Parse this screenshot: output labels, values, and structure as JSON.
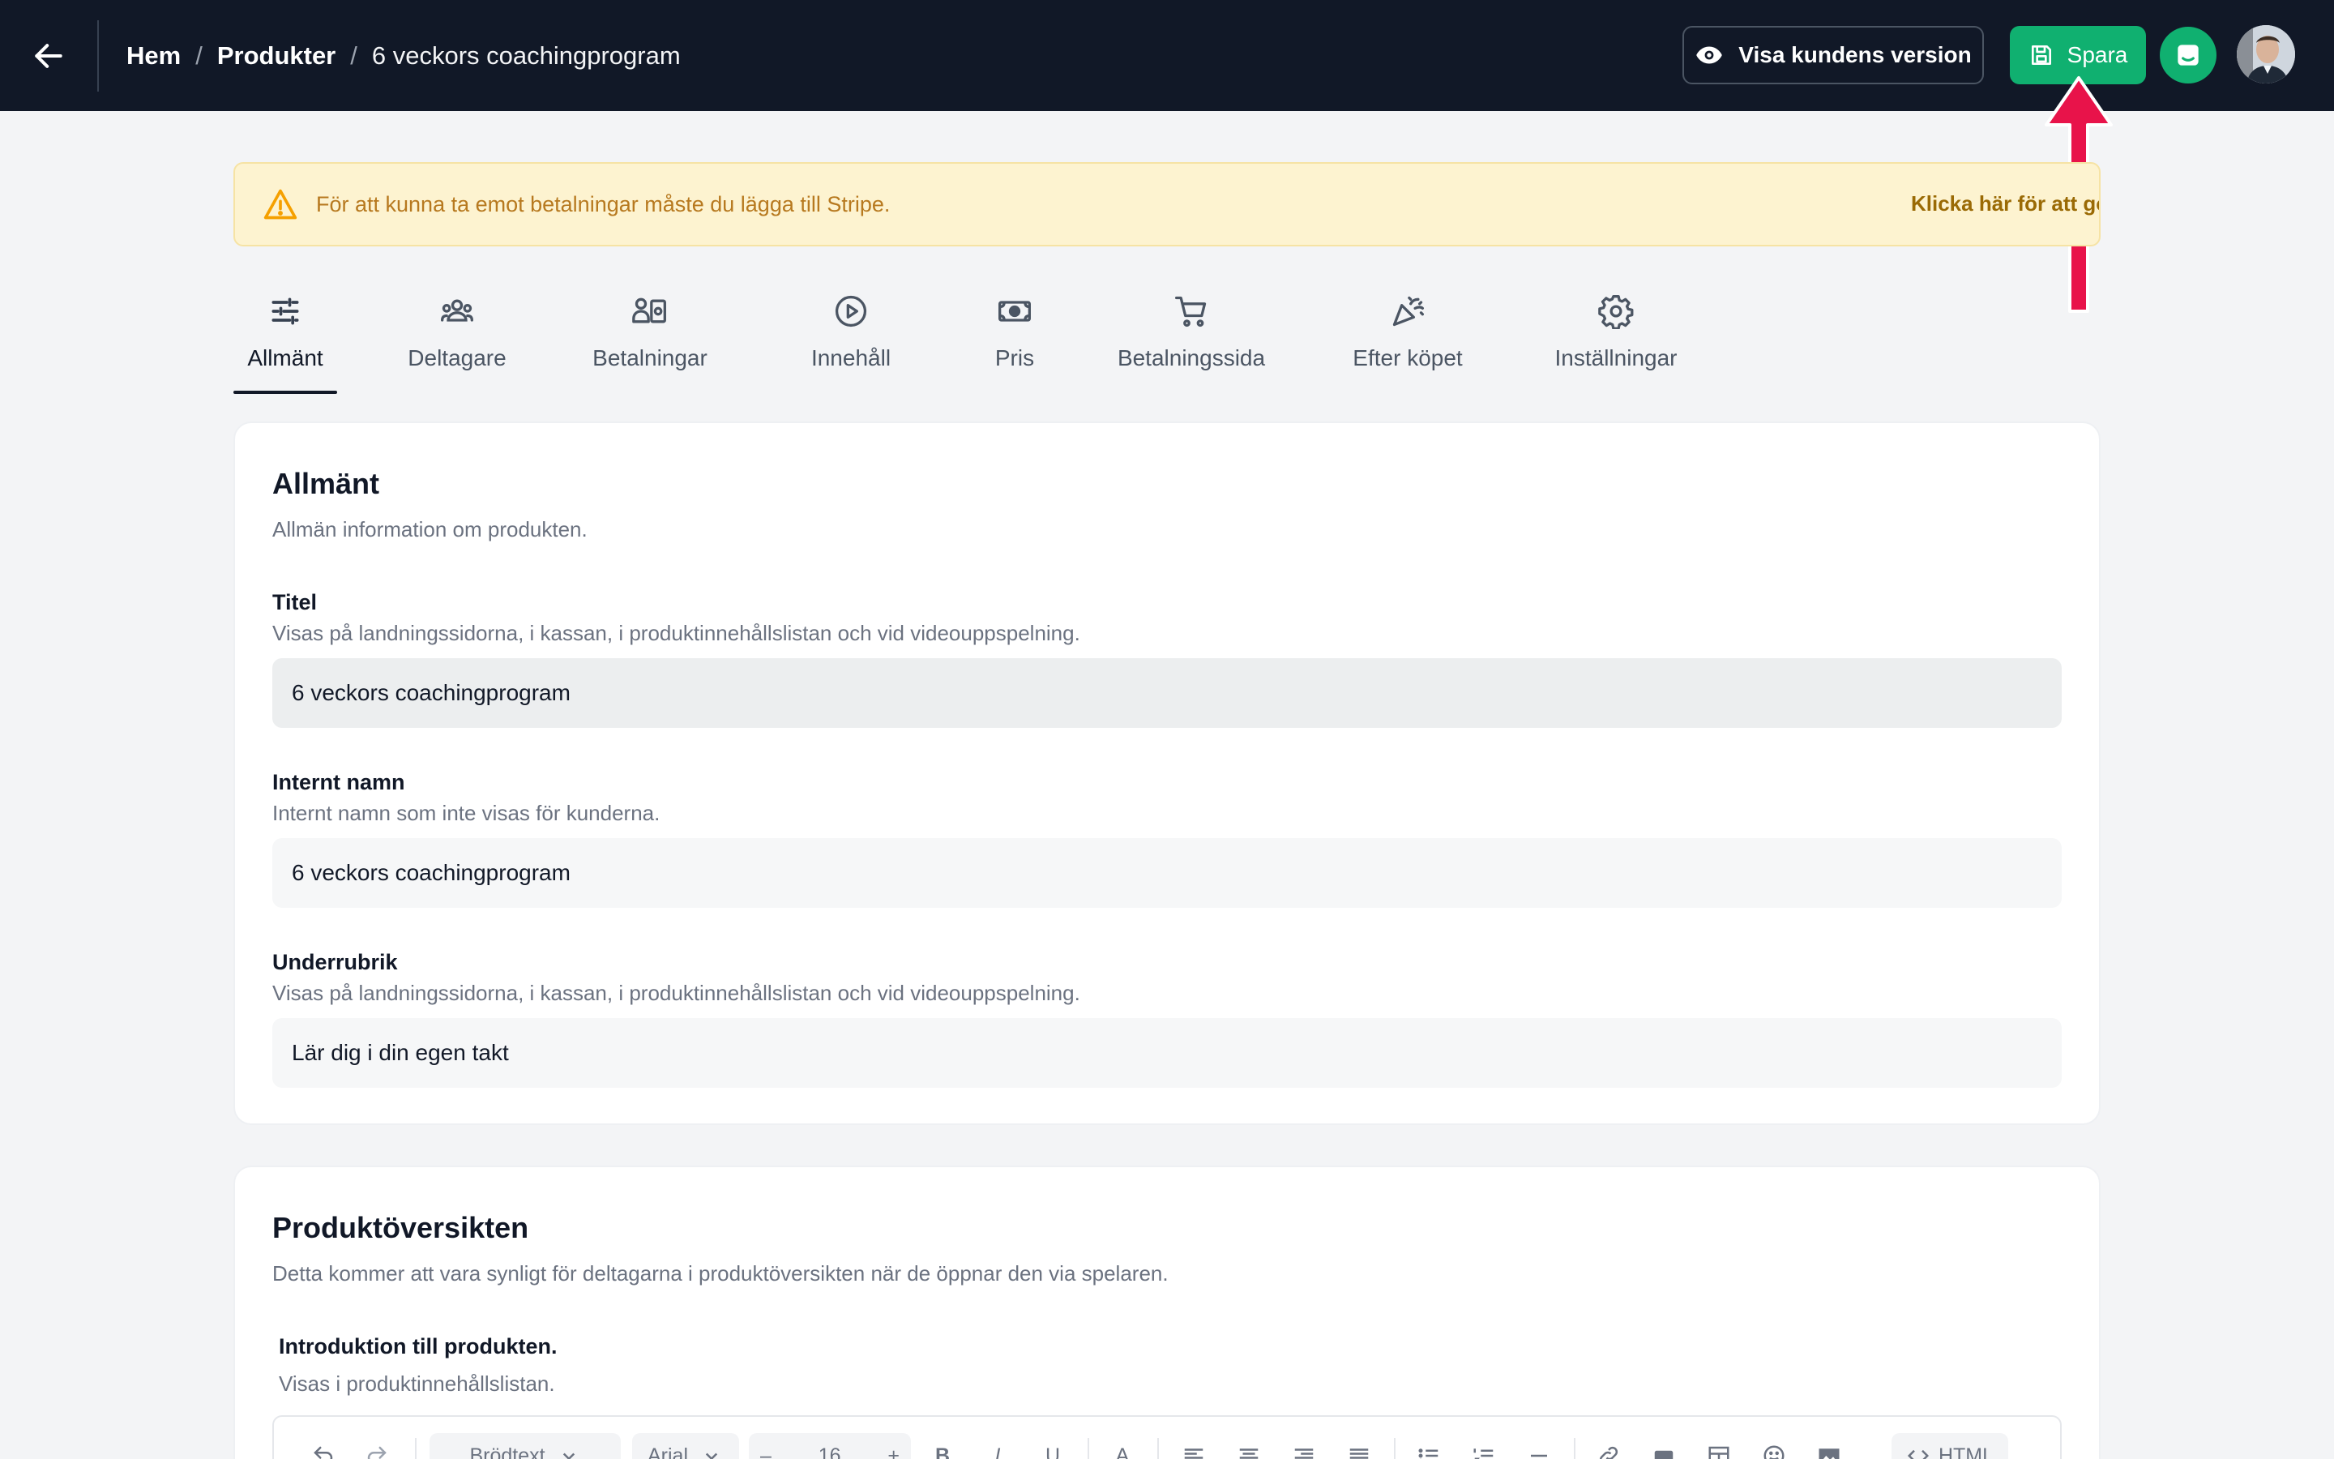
{
  "header": {
    "breadcrumb": {
      "home": "Hem",
      "products": "Produkter",
      "current": "6 veckors coachingprogram",
      "separator": "/"
    },
    "preview_label": "Visa kundens version",
    "save_label": "Spara"
  },
  "banner": {
    "text": "För att kunna ta emot betalningar måste du lägga till Stripe.",
    "link": "Klicka här för att göra det"
  },
  "tabs": [
    {
      "label": "Allmänt",
      "icon": "sliders-icon",
      "active": true
    },
    {
      "label": "Deltagare",
      "icon": "users-icon"
    },
    {
      "label": "Betalningar",
      "icon": "payments-icon"
    },
    {
      "label": "Innehåll",
      "icon": "play-circle-icon"
    },
    {
      "label": "Pris",
      "icon": "money-icon"
    },
    {
      "label": "Betalningssida",
      "icon": "cart-icon"
    },
    {
      "label": "Efter köpet",
      "icon": "party-popper-icon"
    },
    {
      "label": "Inställningar",
      "icon": "gear-icon"
    }
  ],
  "general": {
    "title": "Allmänt",
    "subtitle": "Allmän information om produkten.",
    "fields": {
      "title": {
        "label": "Titel",
        "help": "Visas på landningssidorna, i kassan, i produktinnehållslistan och vid videouppspelning.",
        "value": "6 veckors coachingprogram"
      },
      "internal": {
        "label": "Internt namn",
        "help": "Internt namn som inte visas för kunderna.",
        "value": "6 veckors coachingprogram"
      },
      "subheading": {
        "label": "Underrubrik",
        "help": "Visas på landningssidorna, i kassan, i produktinnehållslistan och vid videouppspelning.",
        "value": "Lär dig i din egen takt"
      }
    }
  },
  "overview": {
    "title": "Produktöversikten",
    "subtitle": "Detta kommer att vara synligt för deltagarna i produktöversikten när de öppnar den via spelaren.",
    "intro_label": "Introduktion till produkten.",
    "intro_help": "Visas i produktinnehållslistan.",
    "toolbar": {
      "block_style": "Brödtext",
      "font": "Arial",
      "font_size": "16",
      "bold": "B",
      "italic": "I",
      "underline": "U",
      "text_color": "A",
      "html": "HTML"
    }
  },
  "colors": {
    "topbar": "#111827",
    "primary": "#10b070",
    "warning_bg": "#fdf3d0",
    "warning_text": "#b7791f",
    "annotation": "#e8134a"
  }
}
